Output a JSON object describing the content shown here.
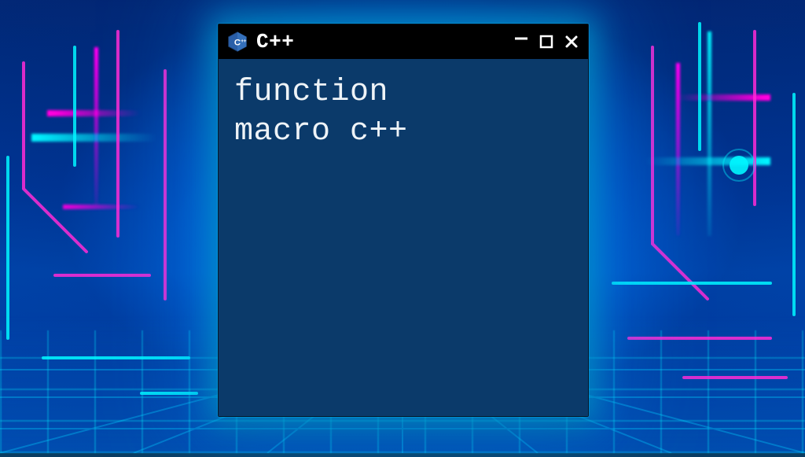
{
  "window": {
    "title": "C++",
    "icon_name": "cpp-hex-icon",
    "controls": {
      "minimize": "–",
      "maximize": "☐",
      "close": "✕"
    }
  },
  "terminal": {
    "content": "function\nmacro c++"
  },
  "colors": {
    "titlebar_bg": "#000000",
    "terminal_bg": "#0b3a6a",
    "text": "#eef3f7",
    "glow": "#00c8ff"
  }
}
